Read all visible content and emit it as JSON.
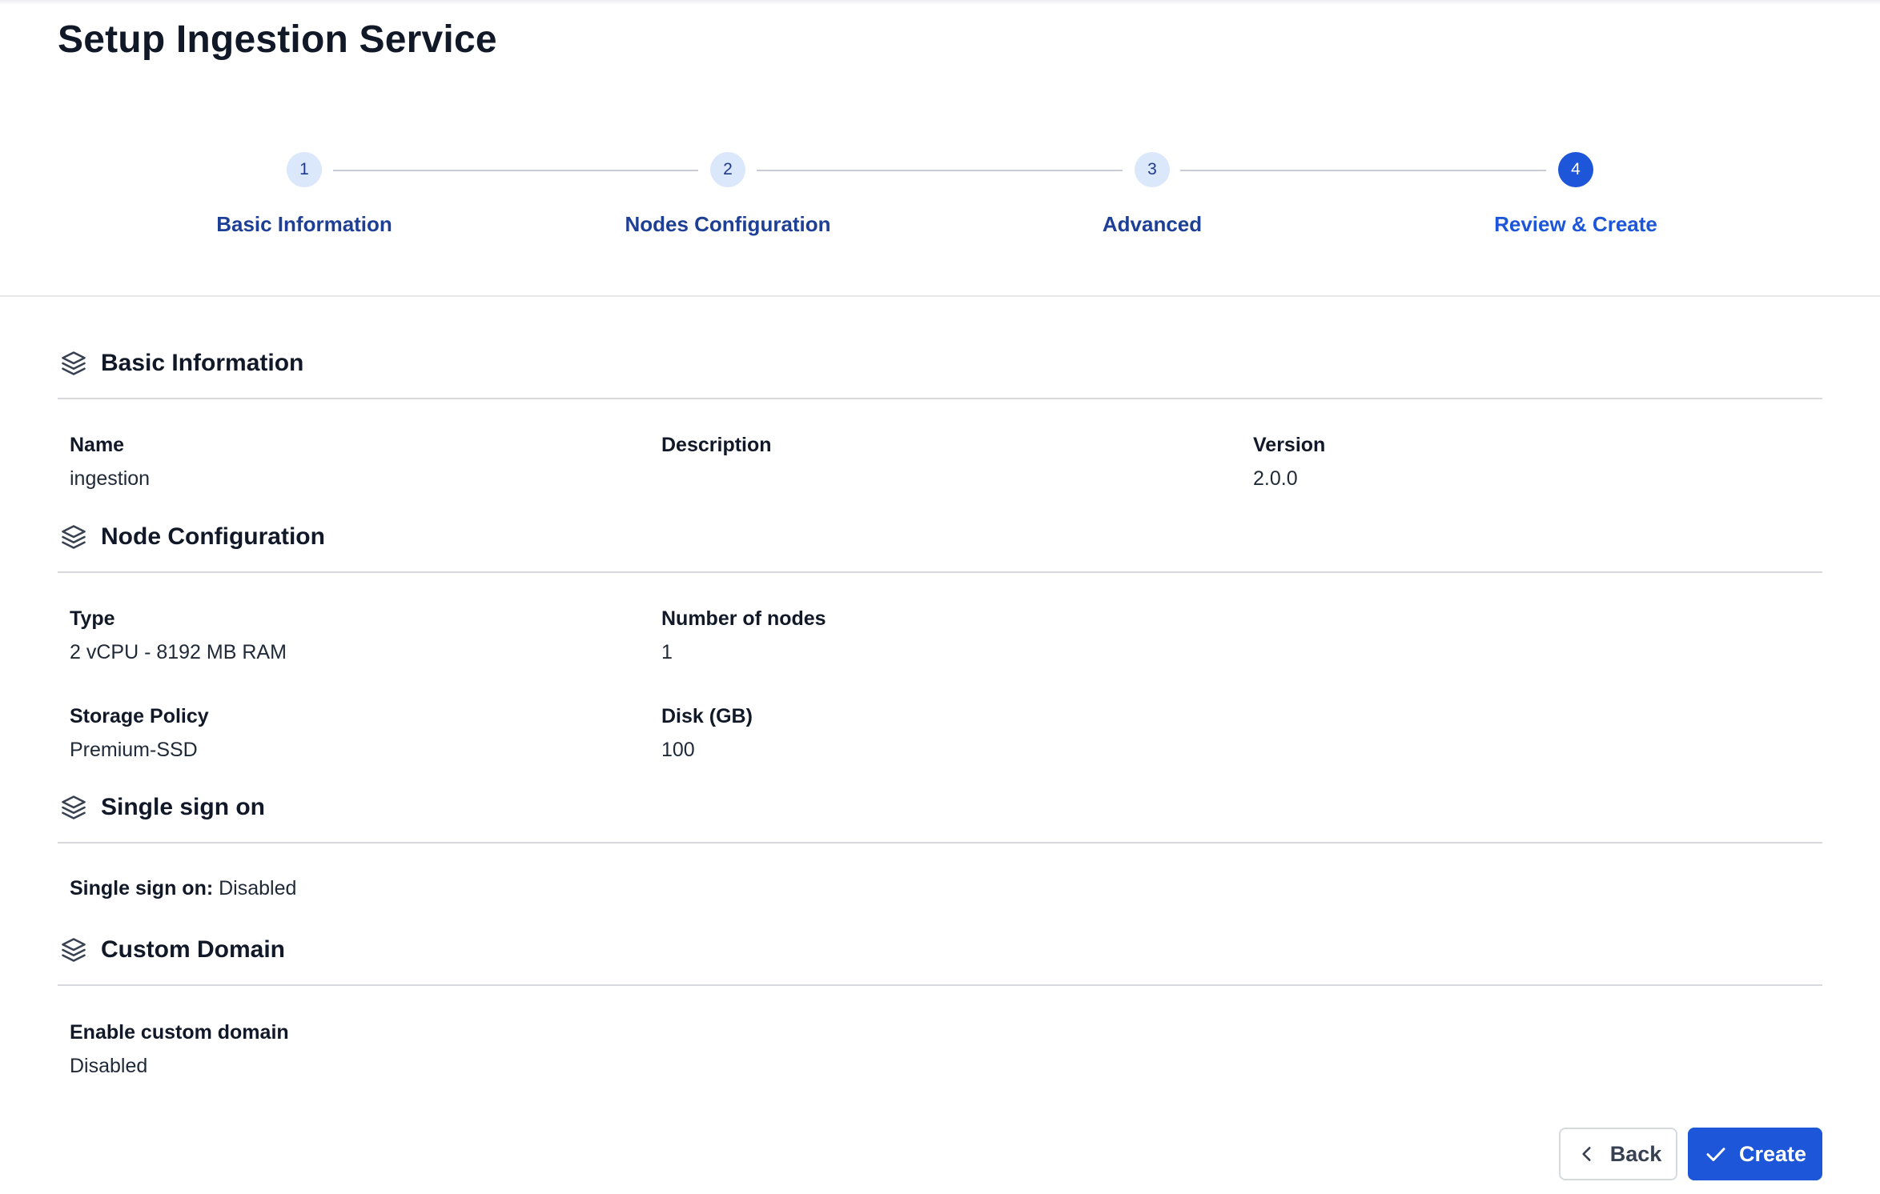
{
  "page": {
    "title": "Setup Ingestion Service"
  },
  "stepper": {
    "steps": [
      {
        "number": "1",
        "label": "Basic Information",
        "state": "complete"
      },
      {
        "number": "2",
        "label": "Nodes Configuration",
        "state": "complete"
      },
      {
        "number": "3",
        "label": "Advanced",
        "state": "complete"
      },
      {
        "number": "4",
        "label": "Review & Create",
        "state": "active"
      }
    ]
  },
  "sections": {
    "basic": {
      "title": "Basic Information",
      "icon": "layers-icon",
      "fields": [
        {
          "label": "Name",
          "value": "ingestion"
        },
        {
          "label": "Description",
          "value": ""
        },
        {
          "label": "Version",
          "value": "2.0.0"
        }
      ]
    },
    "node": {
      "title": "Node Configuration",
      "icon": "layers-icon",
      "fields": [
        {
          "label": "Type",
          "value": "2 vCPU - 8192 MB RAM"
        },
        {
          "label": "Number of nodes",
          "value": "1"
        },
        {
          "label": "Storage Policy",
          "value": "Premium-SSD"
        },
        {
          "label": "Disk (GB)",
          "value": "100"
        }
      ]
    },
    "sso": {
      "title": "Single sign on",
      "icon": "layers-icon",
      "label": "Single sign on:",
      "value": "Disabled"
    },
    "domain": {
      "title": "Custom Domain",
      "icon": "layers-icon",
      "fields": [
        {
          "label": "Enable custom domain",
          "value": "Disabled"
        }
      ]
    }
  },
  "actions": {
    "back_label": "Back",
    "back_icon": "chevron-left-icon",
    "create_label": "Create",
    "create_icon": "check-icon"
  },
  "colors": {
    "accent": "#1d56d8",
    "step_inactive_bg": "#dbe7fb",
    "step_label": "#1e3f96"
  }
}
